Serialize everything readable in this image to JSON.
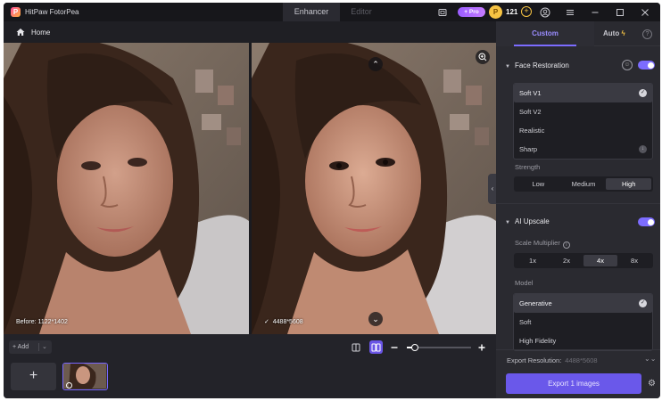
{
  "app": {
    "title": "HitPaw FotorPea",
    "logo_letter": "P"
  },
  "mode_tabs": {
    "enhancer": "Enhancer",
    "editor": "Editor"
  },
  "titlebar": {
    "pro_label": "+ Pro",
    "credits": "121",
    "plus": "+"
  },
  "home": {
    "label": "Home"
  },
  "compare": {
    "before_label": "Before: 1122*1402",
    "after_label": "4488*5608",
    "after_check": "✓"
  },
  "bottombar": {
    "add_label": "+ Add",
    "add_tile": "+"
  },
  "zoom": {
    "level_fraction": 0.13
  },
  "panel": {
    "tab_custom": "Custom",
    "tab_auto": "Auto",
    "help": "?",
    "face_restoration": {
      "title": "Face Restoration",
      "enabled": true,
      "options": [
        "Soft V1",
        "Soft V2",
        "Realistic",
        "Sharp"
      ],
      "selected": "Soft V1",
      "strength_label": "Strength",
      "strength_options": [
        "Low",
        "Medium",
        "High"
      ],
      "strength_selected": "High"
    },
    "ai_upscale": {
      "title": "AI Upscale",
      "enabled": true,
      "scale_label": "Scale Multiplier",
      "scale_options": [
        "1x",
        "2x",
        "4x",
        "8x"
      ],
      "scale_selected": "4x",
      "model_label": "Model",
      "model_options": [
        "Generative",
        "Soft",
        "High Fidelity"
      ],
      "model_selected": "Generative"
    },
    "export_resolution_label": "Export Resolution:",
    "export_resolution_value": "4488*5608",
    "export_button": "Export 1 images"
  },
  "colors": {
    "accent": "#7c6cff",
    "export": "#6a58ea",
    "coin": "#f6c343"
  }
}
